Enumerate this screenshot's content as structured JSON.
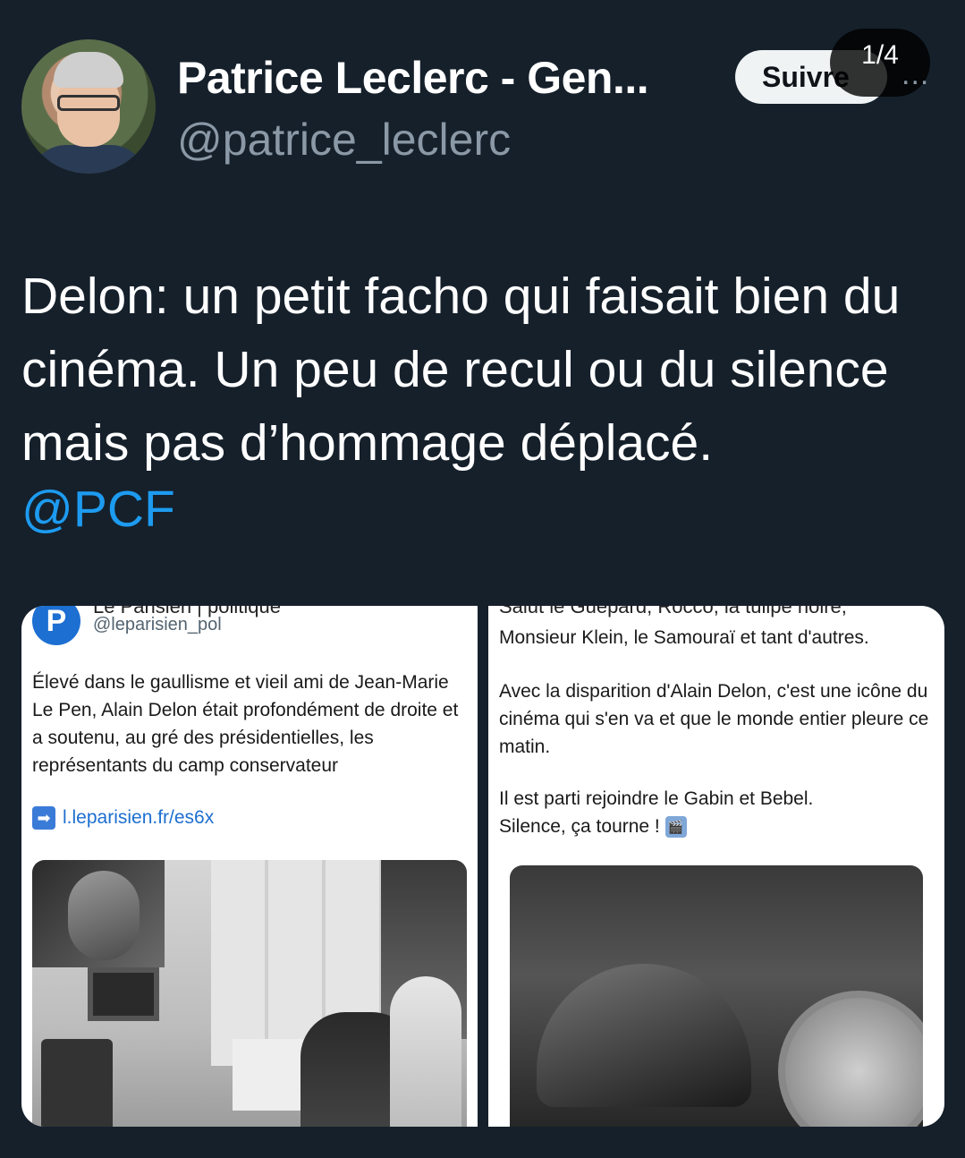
{
  "carousel": {
    "counter": "1/4"
  },
  "tweet": {
    "author_name": "Patrice Leclerc - Gen...",
    "author_handle": "@patrice_leclerc",
    "follow_label": "Suivre",
    "more_icon": "more-icon",
    "more_glyph": "...",
    "text": "Delon: un petit facho qui faisait bien du cinéma. Un peu de recul ou du silence mais pas d’hommage déplacé.",
    "mention": "@PCF"
  },
  "media": {
    "left": {
      "source_title": "Le Parisien | politique",
      "logo_letter": "P",
      "source_handle": "@leparisien_pol",
      "body": "Élevé dans le gaullisme et vieil ami de Jean-Marie Le Pen, Alain Delon était profondément de droite et a soutenu, au gré des présidentielles, les représentants du camp conservateur",
      "link_icon": "right-arrow-icon",
      "link_glyph": "➡",
      "link_text": "l.leparisien.fr/es6x"
    },
    "right": {
      "top_cut_text": "Salut le Guépard, Rocco, la tulipe noire,",
      "line1": "Monsieur Klein, le Samouraï et tant d'autres.",
      "para2": "Avec la disparition d'Alain Delon, c'est une icône du cinéma qui s'en va et que le monde entier pleure ce matin.",
      "para3_line1": "Il est parti rejoindre le Gabin et Bebel.",
      "para3_line2": "Silence, ça tourne !",
      "emoji_icon": "clapperboard-icon",
      "emoji_glyph": "🎬"
    }
  },
  "colors": {
    "background": "#15202b",
    "link": "#1d9bf0",
    "secondary_text": "#8b98a5"
  }
}
